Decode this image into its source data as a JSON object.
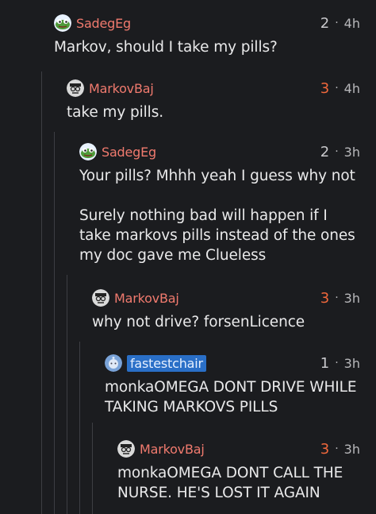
{
  "comments": [
    {
      "user": "SadegEg",
      "score": "2",
      "age": "4h",
      "body": [
        "Markov, should I take my pills?"
      ],
      "avatar": "frog-avatar-icon"
    },
    {
      "user": "MarkovBaj",
      "score": "3",
      "age": "4h",
      "body": [
        "take my pills."
      ],
      "avatar": "markov-avatar-icon"
    },
    {
      "user": "SadegEg",
      "score": "2",
      "age": "3h",
      "body": [
        "Your pills? Mhhh yeah I guess why not",
        "Surely nothing bad will happen if I take markovs pills instead of the ones my doc gave me Clueless"
      ],
      "avatar": "frog-avatar-icon"
    },
    {
      "user": "MarkovBaj",
      "score": "3",
      "age": "3h",
      "body": [
        "why not drive? forsenLicence"
      ],
      "avatar": "markov-avatar-icon"
    },
    {
      "user": "fastestchair",
      "score": "1",
      "age": "3h",
      "body": [
        "monkaOMEGA DONT DRIVE WHILE TAKING MARKOVS PILLS"
      ],
      "avatar": "default-avatar-icon"
    },
    {
      "user": "MarkovBaj",
      "score": "3",
      "age": "3h",
      "body": [
        "monkaOMEGA DONT CALL THE NURSE. HE'S LOST IT AGAIN"
      ],
      "avatar": "markov-avatar-icon"
    }
  ],
  "separator": "·",
  "colors": {
    "background": "#1b1c1f",
    "username": "#f07a6e",
    "hot_score": "#f0683c",
    "flair_bg": "#2a6fc7"
  }
}
